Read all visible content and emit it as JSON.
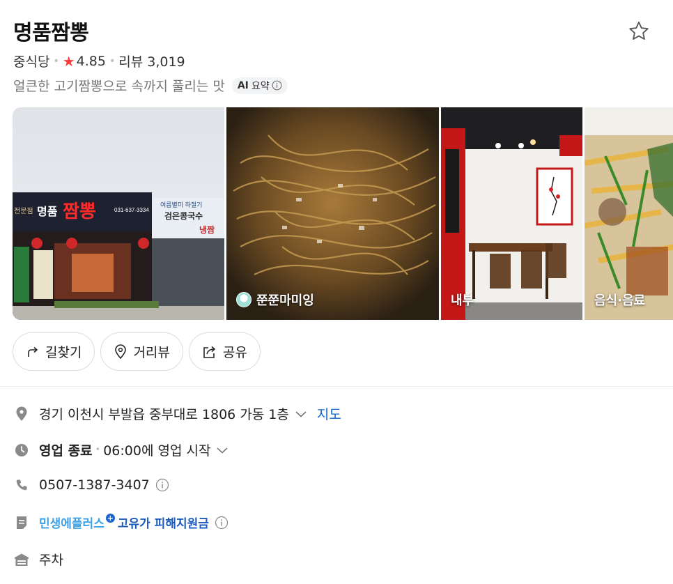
{
  "place": {
    "name": "명품짬뽕",
    "category": "중식당",
    "rating": "4.85",
    "reviews": "리뷰 3,019",
    "summary": "얼큰한 고기짬뽕으로 속까지 풀리는 맛",
    "ai_badge_ai": "AI",
    "ai_badge_label": "요약"
  },
  "photos": [
    {
      "caption": ""
    },
    {
      "caption": "쭌쭌마미잉"
    },
    {
      "caption": "내부"
    },
    {
      "caption": "음식·음료"
    }
  ],
  "sign": {
    "brand": "명품",
    "brand_red": "짬뽕",
    "prefix": "전문점",
    "phone": "031-637-3334",
    "banner_top": "여름별미 하절기",
    "banner_mid": "검은콩국수",
    "banner_bot": "냉짬"
  },
  "actions": [
    {
      "label": "길찾기",
      "icon": "directions-icon"
    },
    {
      "label": "거리뷰",
      "icon": "location-pin-icon"
    },
    {
      "label": "공유",
      "icon": "share-icon"
    }
  ],
  "info": {
    "address": "경기 이천시 부발읍 중부대로 1806 가동 1층",
    "map_link": "지도",
    "hours_status": "영업 종료",
    "hours_next": "06:00에 영업 시작",
    "phone": "0507-1387-3407",
    "promo_part1": "민생에플러스",
    "promo_plus": "+",
    "promo_part2": "고유가 피해지원금",
    "parking": "주차"
  },
  "colors": {
    "rating_star": "#ff3a3a",
    "link": "#0a66d6",
    "promo_light": "#3aa0e6",
    "promo_dark": "#1b5bbf"
  }
}
